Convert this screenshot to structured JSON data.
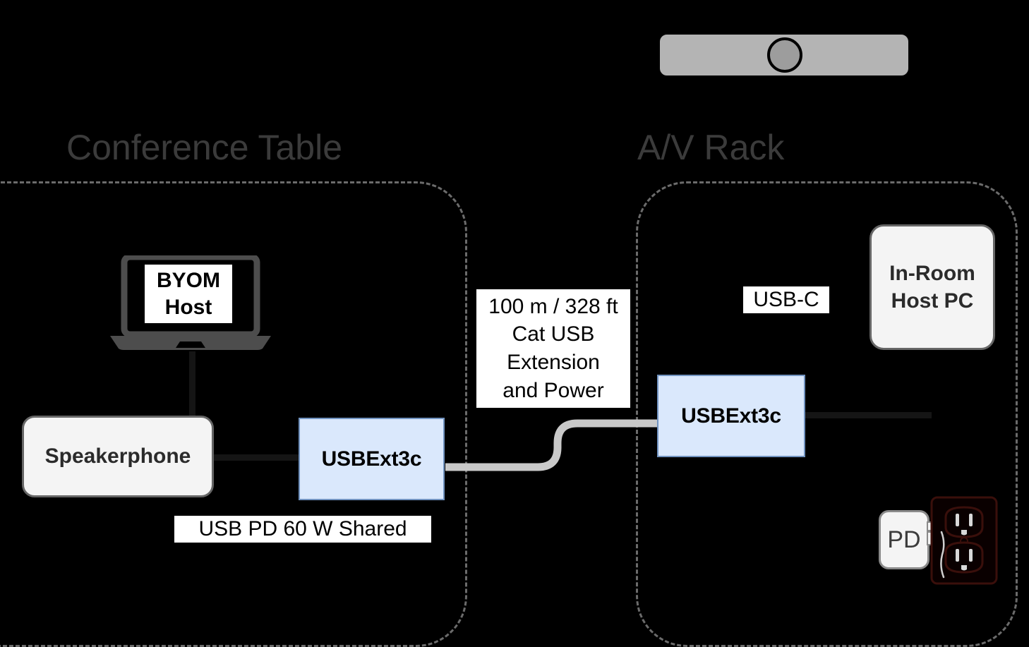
{
  "diagram": {
    "title": "USB extension BYOM / in-room host connectivity diagram",
    "background_color": "#000000",
    "accent_blue_fill": "#dae8fc",
    "accent_blue_stroke": "#7193c0",
    "zone_stroke_color": "#6b6b6b",
    "cable_color": "#c9c9c9",
    "soft_box_fill": "#f4f4f4",
    "soft_box_stroke": "#666666",
    "title_color": "#3b3b3b"
  },
  "zones": [
    {
      "id": "conference-table",
      "label": "Conference Table"
    },
    {
      "id": "av-rack",
      "label": "A/V Rack"
    }
  ],
  "devices": {
    "camera_bar": {
      "name": "camera-soundbar",
      "lens": "lens"
    },
    "byom_host": {
      "label": "BYOM\nHost",
      "line1": "BYOM",
      "line2": "Host"
    },
    "speakerphone": {
      "label": "Speakerphone"
    },
    "usb_ext_left": {
      "label": "USBExt3c"
    },
    "usb_ext_right": {
      "label": "USBExt3c"
    },
    "in_room_host_pc": {
      "label": "In-Room\nHost PC",
      "line1": "In-Room",
      "line2": "Host PC"
    },
    "power_adapter": {
      "label": "PD"
    },
    "wall_outlet": {
      "name": "wall-outlet"
    }
  },
  "edge_labels": {
    "cat_extension": "100 m / 328 ft\nCat USB\nExtension\nand Power",
    "usb_pd_shared": "USB PD 60 W Shared",
    "usb_c": "USB-C"
  }
}
